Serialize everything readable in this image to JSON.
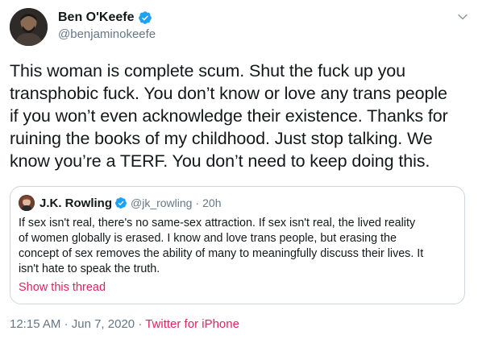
{
  "author": {
    "display_name": "Ben O'Keefe",
    "handle": "@benjaminokeefe"
  },
  "tweet": {
    "text": "This woman is complete scum. Shut the fuck up you\ntransphobic fuck. You don’t know or love any trans people\nif you won’t even acknowledge their existence. Thanks for\nruining the books of my childhood. Just stop talking. We\nknow you’re a TERF. You don’t need to keep doing this."
  },
  "quoted_tweet": {
    "display_name": "J.K. Rowling",
    "handle": "@jk_rowling",
    "separator": "·",
    "time": "20h",
    "text": "If sex isn't real, there's no same-sex attraction. If sex isn't real, the lived reality\nof women globally is erased. I know and love trans people, but erasing the\nconcept of sex removes the ability of many to meaningfully discuss their lives. It\nisn't hate to speak the truth.",
    "show_thread_label": "Show this thread"
  },
  "meta": {
    "time": "12:15 AM",
    "separator": "·",
    "date": "Jun 7, 2020",
    "source": "Twitter for iPhone"
  },
  "colors": {
    "verified_blue": "#1da1f2",
    "link_pink": "#e0245e",
    "secondary_text": "#657786",
    "border": "#ccd6dd"
  },
  "icons": {
    "verified": "verified-badge-icon",
    "caret": "chevron-down-icon"
  }
}
